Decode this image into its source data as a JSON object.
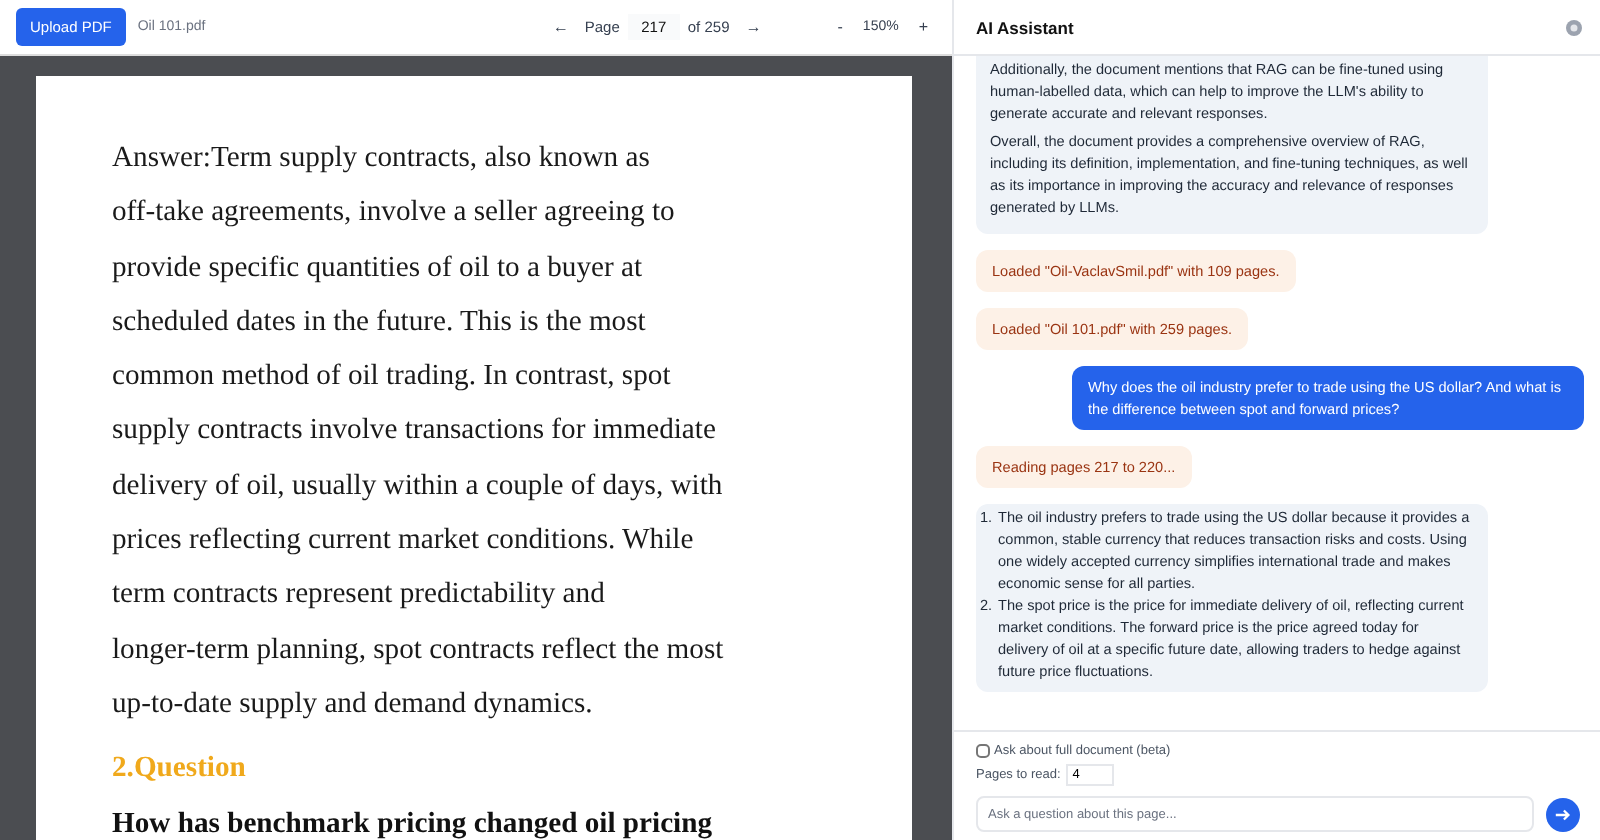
{
  "toolbar": {
    "upload_button": "Upload PDF",
    "file_name": "Oil 101.pdf",
    "prev": "←",
    "page_label": "Page",
    "page_value": "217",
    "page_total": "of 259",
    "next": "→",
    "zoom_out": "-",
    "zoom": "150%",
    "zoom_in": "+"
  },
  "document": {
    "blocks": [
      {
        "kind": "body",
        "lines": [
          "Answer:Term supply contracts, also known as",
          "off-take agreements, involve a seller agreeing to",
          "provide specific quantities of oil to a buyer at",
          "scheduled dates in the future. This is the most",
          "common method of oil trading. In contrast, spot",
          "supply contracts involve transactions for immediate",
          "delivery of oil, usually within a couple of days, with",
          "prices reflecting current market conditions. While",
          "term contracts represent predictability and",
          "longer-term planning, spot contracts reflect the most",
          "up-to-date supply and demand dynamics."
        ]
      },
      {
        "kind": "heading",
        "lines": [
          "2.Question"
        ]
      },
      {
        "kind": "question",
        "lines": [
          "How has benchmark pricing changed oil pricing"
        ]
      }
    ]
  },
  "assistant_panel": {
    "title": "AI Assistant",
    "messages": [
      {
        "kind": "assistant",
        "paragraphs": [
          "Additionally, the document mentions that RAG can be fine-tuned using human-labelled data, which can help to improve the LLM's ability to generate accurate and relevant responses.",
          "Overall, the document provides a comprehensive overview of RAG, including its definition, implementation, and fine-tuning techniques, as well as its importance in improving the accuracy and relevance of responses generated by LLMs."
        ]
      },
      {
        "kind": "status",
        "text": "Loaded \"Oil-VaclavSmil.pdf\" with 109 pages."
      },
      {
        "kind": "status",
        "text": "Loaded \"Oil 101.pdf\" with 259 pages."
      },
      {
        "kind": "user",
        "text": "Why does the oil industry prefer to trade using the US dollar? And what is the difference between spot and forward prices?"
      },
      {
        "kind": "status",
        "text": "Reading pages 217 to 220..."
      },
      {
        "kind": "list",
        "items": [
          {
            "marker": "1.",
            "text": "The oil industry prefers to trade using the US dollar because it provides a common, stable currency that reduces transaction risks and costs. Using one widely accepted currency simplifies international trade and makes economic sense for all parties."
          },
          {
            "marker": "2.",
            "text": "The spot price is the price for immediate delivery of oil, reflecting current market conditions. The forward price is the price agreed today for delivery of oil at a specific future date, allowing traders to hedge against future price fluctuations."
          }
        ]
      }
    ],
    "full_document": {
      "label": "Ask about full document (beta)",
      "checked": false
    },
    "pages_to_read": {
      "label": "Pages to read:",
      "value": "4"
    },
    "question_field": {
      "placeholder": "Ask a question about this page..."
    }
  }
}
